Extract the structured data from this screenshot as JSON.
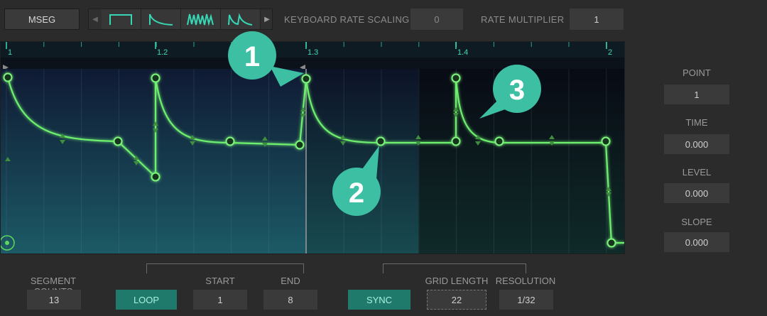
{
  "header": {
    "mseg_label": "MSEG",
    "keyboard_rate_scaling_label": "KEYBOARD RATE SCALING",
    "keyboard_rate_scaling_value": "0",
    "rate_multiplier_label": "RATE MULTIPLIER",
    "rate_multiplier_value": "1"
  },
  "ruler": {
    "marks": [
      {
        "label": "1",
        "bar": 1.0
      },
      {
        "label": "1.2",
        "bar": 1.2
      },
      {
        "label": "1.3",
        "bar": 1.3
      },
      {
        "label": "1.4",
        "bar": 1.4
      },
      {
        "label": "2",
        "bar": 2.0
      }
    ]
  },
  "point_panel": {
    "point_label": "POINT",
    "point_value": "1",
    "time_label": "TIME",
    "time_value": "0.000",
    "level_label": "LEVEL",
    "level_value": "0.000",
    "slope_label": "SLOPE",
    "slope_value": "0.000"
  },
  "footer": {
    "segment_counts_label": "SEGMENT COUNTS",
    "segment_counts_value": "13",
    "loop_label": "LOOP",
    "start_label": "START",
    "start_value": "1",
    "end_label": "END",
    "end_value": "8",
    "sync_label": "SYNC",
    "grid_length_label": "GRID LENGTH",
    "grid_length_value": "22",
    "resolution_label": "RESOLUTION",
    "resolution_value": "1/32"
  },
  "callouts": [
    {
      "number": "1"
    },
    {
      "number": "2"
    },
    {
      "number": "3"
    }
  ],
  "colors": {
    "accent": "#6ef06e",
    "toggle_on": "#1f7a6c",
    "callout": "#3dbfa3"
  }
}
